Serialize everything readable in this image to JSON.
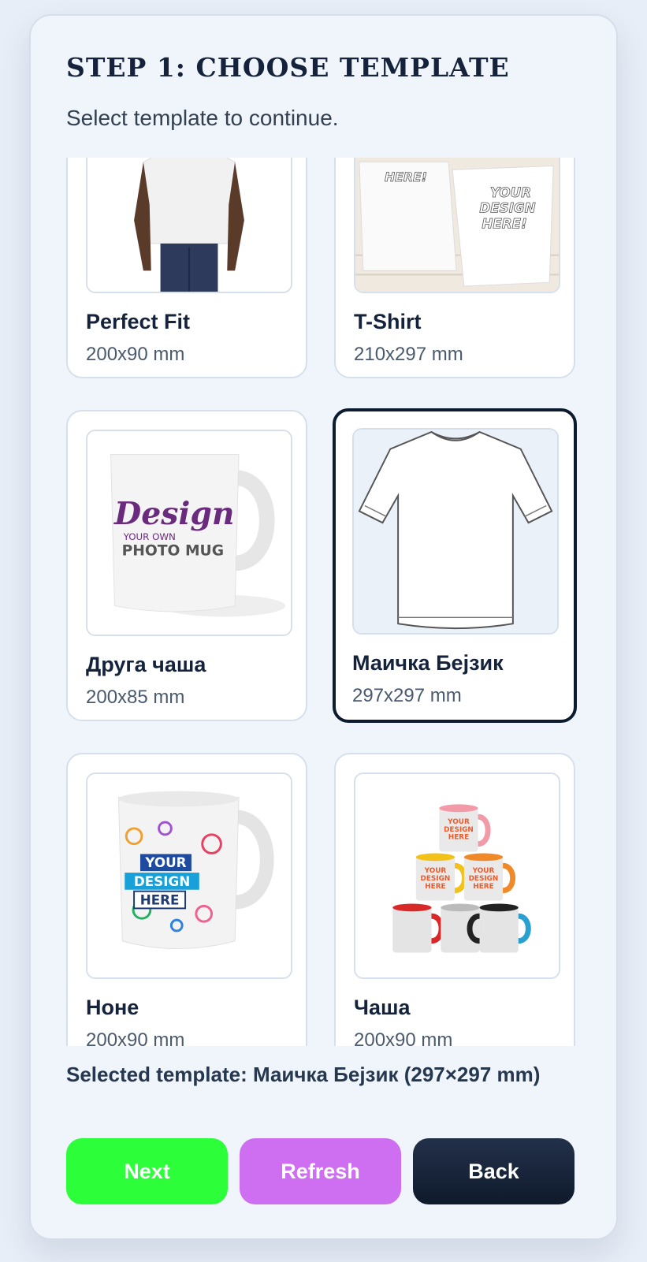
{
  "header": {
    "title": "STEP 1: CHOOSE TEMPLATE",
    "subtitle": "Select template to continue."
  },
  "templates": [
    {
      "name": "Perfect Fit",
      "size": "200x90 mm",
      "image": "white-tshirt-model-photo",
      "selected": false
    },
    {
      "name": "T-Shirt",
      "size": "210x297 mm",
      "image": "shirts-your-design-here-photo",
      "selected": false
    },
    {
      "name": "Друга чаша",
      "size": "200x85 mm",
      "image": "design-your-own-photo-mug",
      "selected": false
    },
    {
      "name": "Маичка Бејзик",
      "size": "297x297 mm",
      "image": "tshirt-outline-drawing",
      "selected": true
    },
    {
      "name": "Ноне",
      "size": "200x90 mm",
      "image": "your-design-here-mug",
      "selected": false
    },
    {
      "name": "Чаша",
      "size": "200x90 mm",
      "image": "stacked-colored-mugs",
      "selected": false
    }
  ],
  "thumb_text": {
    "here": "HERE!",
    "your_design_here": [
      "YOUR",
      "DESIGN",
      "HERE!"
    ],
    "mug_design": "Design",
    "mug_your_own": "YOUR OWN",
    "mug_photo_mug": "PHOTO MUG",
    "mug2_lines": [
      "YOUR",
      "DESIGN",
      "HERE"
    ],
    "small_mug_lines": [
      "YOUR",
      "DESIGN",
      "HERE"
    ]
  },
  "selection": {
    "text": "Selected template: Маичка Бејзик (297×297 mm)"
  },
  "buttons": {
    "next": "Next",
    "refresh": "Refresh",
    "back": "Back"
  },
  "colors": {
    "next": "#2cff3a",
    "refresh": "#cd6ff0",
    "back": "#14213a",
    "selected_border": "#0d1b2e"
  }
}
